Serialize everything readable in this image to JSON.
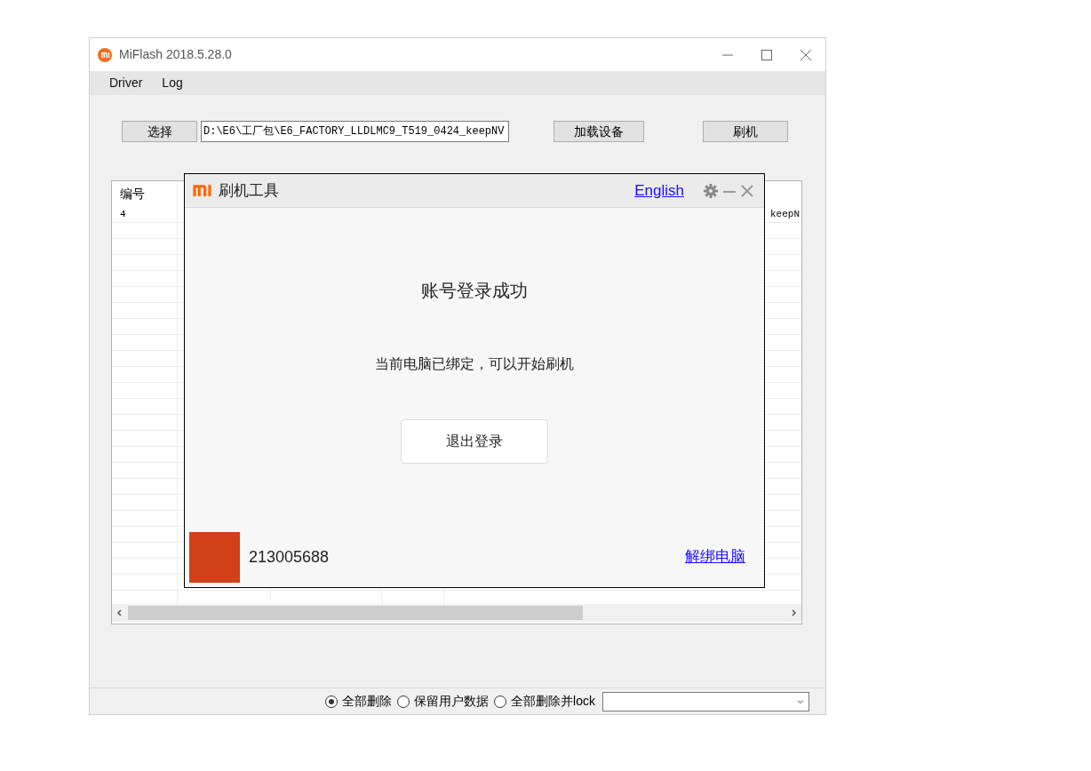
{
  "window": {
    "title": "MiFlash 2018.5.28.0"
  },
  "menu": [
    "Driver",
    "Log"
  ],
  "toolbar": {
    "select_button": "选择",
    "path_field": "D:\\E6\\工厂包\\E6_FACTORY_LLDLMC9_T519_0424_keepNV",
    "load_button": "加载设备",
    "flash_button": "刷机"
  },
  "table": {
    "columns": [
      "编号"
    ],
    "rows": [
      {
        "column_1": "4",
        "column_6": "keepN"
      }
    ]
  },
  "dialog": {
    "title": "刷机工具",
    "language_link": "English",
    "heading": "账号登录成功",
    "message": "当前电脑已绑定，可以开始刷机",
    "logout_button": "退出登录",
    "account_id": "213005688",
    "unbind_link": "解绑电脑"
  },
  "options": [
    {
      "label": "全部删除",
      "selected": true
    },
    {
      "label": "保留用户数据",
      "selected": false
    },
    {
      "label": "全部删除并lock",
      "selected": false
    }
  ]
}
